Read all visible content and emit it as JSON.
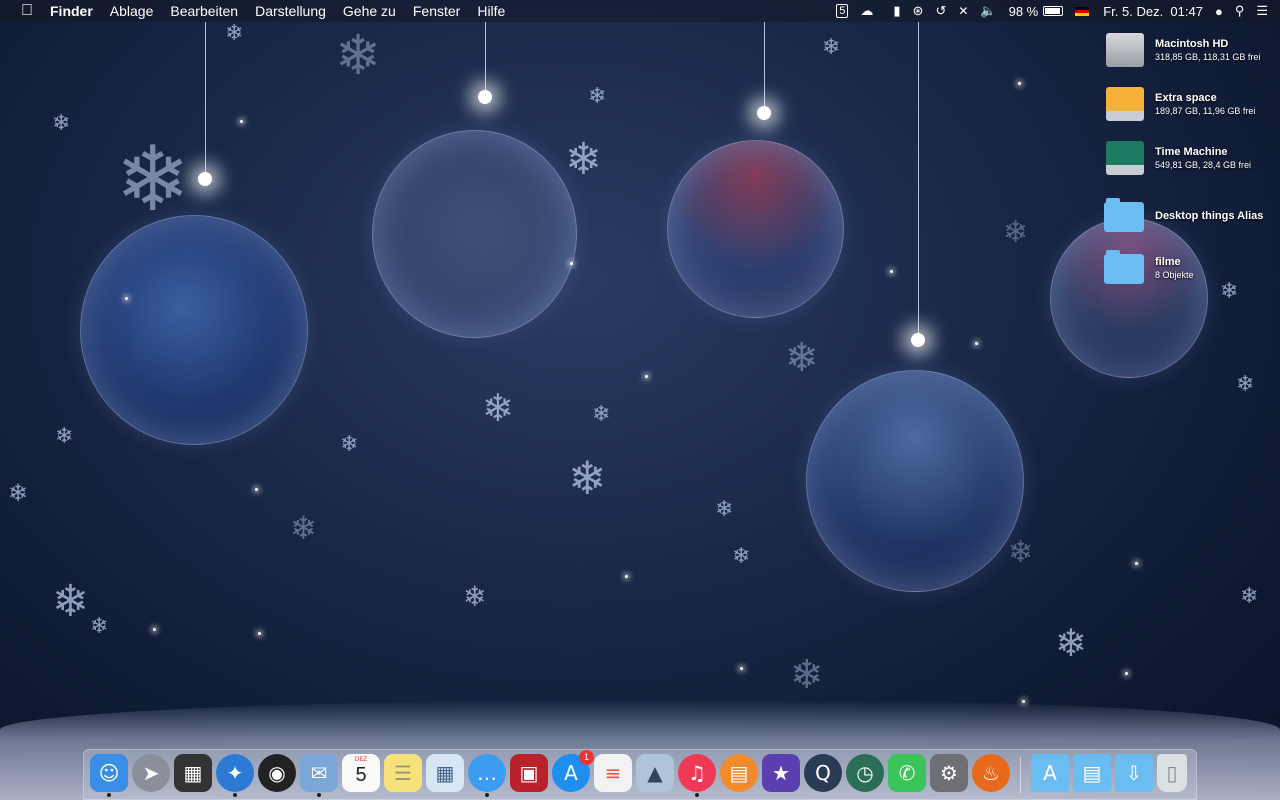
{
  "menubar": {
    "apple_icon": "apple-icon",
    "app_name": "Finder",
    "items": [
      "Ablage",
      "Bearbeiten",
      "Darstellung",
      "Gehe zu",
      "Fenster",
      "Hilfe"
    ],
    "status": {
      "battery_percent": "98 %",
      "datetime": "Fr. 5. Dez.  01:47"
    }
  },
  "desktop_items": [
    {
      "name": "Macintosh HD",
      "info": "318,85 GB, 118,31 GB frei",
      "icon": "hard-drive-icon"
    },
    {
      "name": "Extra space",
      "info": "189,87 GB, 11,96 GB frei",
      "icon": "external-drive-icon"
    },
    {
      "name": "Time Machine",
      "info": "549,81 GB, 28,4 GB frei",
      "icon": "time-machine-drive-icon"
    },
    {
      "name": "Desktop things Alias",
      "info": "",
      "icon": "folder-alias-icon"
    },
    {
      "name": "filme",
      "info": "8 Objekte",
      "icon": "folder-icon"
    }
  ],
  "dock": {
    "apps": [
      {
        "name": "finder",
        "color": "#3a8ee6",
        "running": true
      },
      {
        "name": "launchpad",
        "color": "#8a8f99",
        "running": false
      },
      {
        "name": "mission-control",
        "color": "#333",
        "running": false
      },
      {
        "name": "safari",
        "color": "#2a7ad6",
        "running": true
      },
      {
        "name": "dashboard",
        "color": "#222",
        "running": false
      },
      {
        "name": "mail",
        "color": "#7aa7d8",
        "running": true
      },
      {
        "name": "calendar",
        "color": "#fafafa",
        "running": false,
        "month": "DEZ",
        "day": "5"
      },
      {
        "name": "notes",
        "color": "#f5e27a",
        "running": false
      },
      {
        "name": "preview",
        "color": "#d6e6f5",
        "running": false
      },
      {
        "name": "messages",
        "color": "#3b9cf0",
        "running": true
      },
      {
        "name": "photo-booth",
        "color": "#b8232b",
        "running": false
      },
      {
        "name": "app-store",
        "color": "#1e8ef0",
        "running": false,
        "badge": "1"
      },
      {
        "name": "reminders",
        "color": "#f2f2f2",
        "running": false
      },
      {
        "name": "iphoto",
        "color": "#b0c4d8",
        "running": false
      },
      {
        "name": "itunes",
        "color": "#f03a55",
        "running": true
      },
      {
        "name": "ibooks",
        "color": "#f28a2e",
        "running": false
      },
      {
        "name": "imovie",
        "color": "#5b3fb0",
        "running": false
      },
      {
        "name": "quicktime",
        "color": "#2a3a55",
        "running": false
      },
      {
        "name": "time-machine",
        "color": "#2a6e55",
        "running": false
      },
      {
        "name": "facetime",
        "color": "#3ac45a",
        "running": false
      },
      {
        "name": "system-preferences",
        "color": "#6d6f75",
        "running": false
      },
      {
        "name": "firefox",
        "color": "#e66a1a",
        "running": false
      }
    ],
    "folders": [
      {
        "name": "applications-folder",
        "color": "#6bbcf0"
      },
      {
        "name": "documents-folder",
        "color": "#6bbcf0"
      },
      {
        "name": "downloads-folder",
        "color": "#6bbcf0"
      },
      {
        "name": "trash",
        "color": "#dcdfe4"
      }
    ]
  }
}
